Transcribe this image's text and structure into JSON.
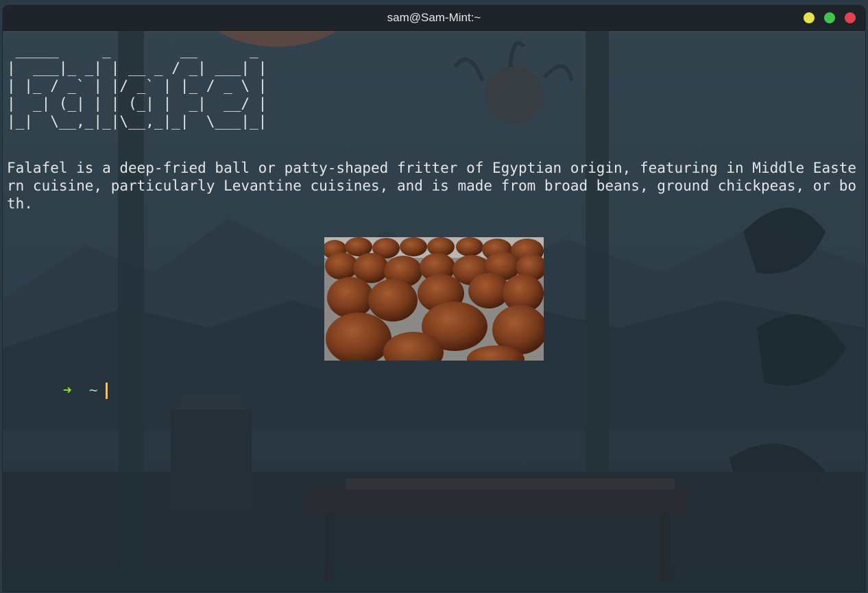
{
  "window": {
    "title": "sam@Sam-Mint:~"
  },
  "terminal": {
    "ascii_art": " _____     _        __      _\n|  ___|_ _| | __ _ / _| ___| |\n| |_ / _` | |/ _` | |_ / _ \\ |\n|  _| (_| | | (_| |  _|  __/ |\n|_|  \\__,_|_|\\__,_|_|  \\___|_|",
    "description": "Falafel is a deep-fried ball or patty-shaped fritter of Egyptian origin, featuring in Middle Eastern cuisine, particularly Levantine cuisines, and is made from broad beans, ground chickpeas, or both.",
    "prompt_arrow": "➜",
    "prompt_dir": "~"
  },
  "colors": {
    "title_bar": "#1e2429",
    "minimize": "#e8e24a",
    "maximize": "#3ec64a",
    "close": "#e5414e",
    "prompt_arrow": "#8ae234",
    "prompt_dir": "#9fd2c7",
    "cursor": "#f0c46a"
  },
  "icons": [
    "minimize-button",
    "maximize-button",
    "close-button",
    "falafel-photo"
  ]
}
